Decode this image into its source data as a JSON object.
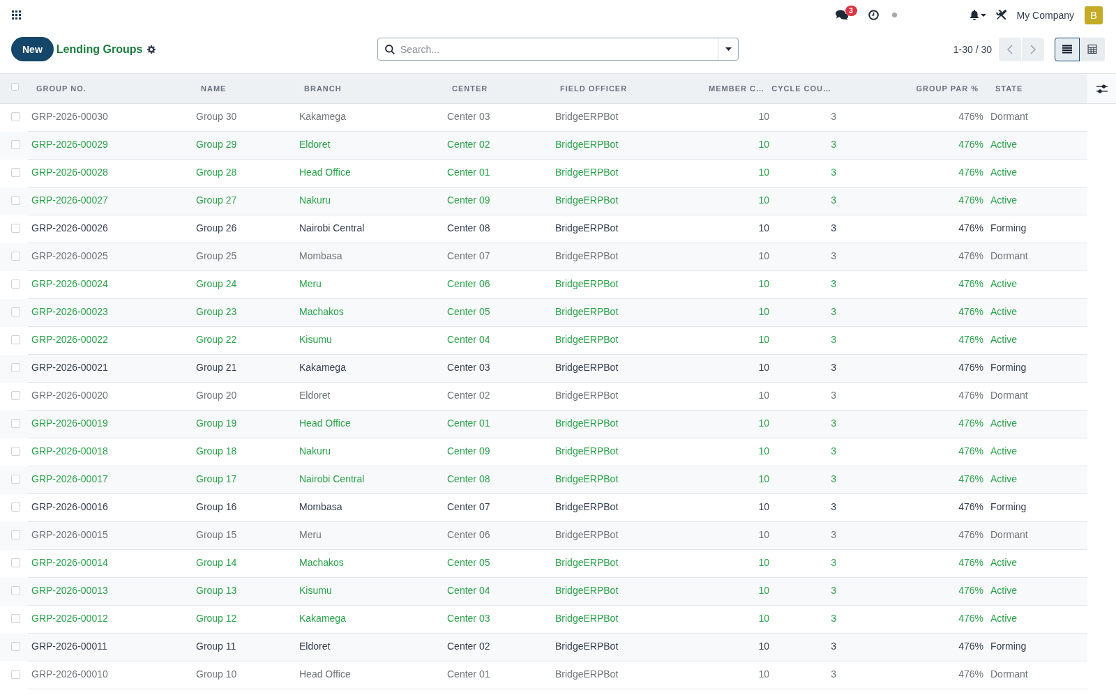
{
  "top_bar": {
    "messages": {
      "badge": "3"
    },
    "company": "My Company",
    "user": {
      "initial": "B"
    }
  },
  "control_panel": {
    "new_button": "New",
    "title": "Lending Groups",
    "search": {
      "placeholder": "Search..."
    },
    "pager": "1-30 / 30",
    "views": [
      {
        "kind": "list",
        "selected": true
      },
      {
        "kind": "pivot",
        "selected": false
      }
    ]
  },
  "table": {
    "select_all": {
      "checked": false
    },
    "columns": [
      {
        "label": "GROUP NO.",
        "kind": "text"
      },
      {
        "label": "NAME",
        "kind": "text"
      },
      {
        "label": "BRANCH",
        "kind": "text"
      },
      {
        "label": "CENTER",
        "kind": "text"
      },
      {
        "label": "FIELD OFFICER",
        "kind": "text"
      },
      {
        "label": "MEMBER C…",
        "kind": "number"
      },
      {
        "label": "CYCLE COU…",
        "kind": "number"
      },
      {
        "label": "GROUP PAR %",
        "kind": "number"
      },
      {
        "label": "STATE",
        "kind": "text"
      }
    ],
    "rows": [
      {
        "kind": "muted",
        "checked": false,
        "cells": [
          "GRP-2026-00030",
          "Group 30",
          "Kakamega",
          "Center 03",
          "BridgeERPBot",
          "10",
          "3",
          "476%",
          "Dormant"
        ]
      },
      {
        "kind": "success",
        "checked": false,
        "cells": [
          "GRP-2026-00029",
          "Group 29",
          "Eldoret",
          "Center 02",
          "BridgeERPBot",
          "10",
          "3",
          "476%",
          "Active"
        ]
      },
      {
        "kind": "success",
        "checked": false,
        "cells": [
          "GRP-2026-00028",
          "Group 28",
          "Head Office",
          "Center 01",
          "BridgeERPBot",
          "10",
          "3",
          "476%",
          "Active"
        ]
      },
      {
        "kind": "success",
        "checked": false,
        "cells": [
          "GRP-2026-00027",
          "Group 27",
          "Nakuru",
          "Center 09",
          "BridgeERPBot",
          "10",
          "3",
          "476%",
          "Active"
        ]
      },
      {
        "kind": "plain",
        "checked": false,
        "cells": [
          "GRP-2026-00026",
          "Group 26",
          "Nairobi Central",
          "Center 08",
          "BridgeERPBot",
          "10",
          "3",
          "476%",
          "Forming"
        ]
      },
      {
        "kind": "muted",
        "checked": false,
        "cells": [
          "GRP-2026-00025",
          "Group 25",
          "Mombasa",
          "Center 07",
          "BridgeERPBot",
          "10",
          "3",
          "476%",
          "Dormant"
        ]
      },
      {
        "kind": "success",
        "checked": false,
        "cells": [
          "GRP-2026-00024",
          "Group 24",
          "Meru",
          "Center 06",
          "BridgeERPBot",
          "10",
          "3",
          "476%",
          "Active"
        ]
      },
      {
        "kind": "success",
        "checked": false,
        "cells": [
          "GRP-2026-00023",
          "Group 23",
          "Machakos",
          "Center 05",
          "BridgeERPBot",
          "10",
          "3",
          "476%",
          "Active"
        ]
      },
      {
        "kind": "success",
        "checked": false,
        "cells": [
          "GRP-2026-00022",
          "Group 22",
          "Kisumu",
          "Center 04",
          "BridgeERPBot",
          "10",
          "3",
          "476%",
          "Active"
        ]
      },
      {
        "kind": "plain",
        "checked": false,
        "cells": [
          "GRP-2026-00021",
          "Group 21",
          "Kakamega",
          "Center 03",
          "BridgeERPBot",
          "10",
          "3",
          "476%",
          "Forming"
        ]
      },
      {
        "kind": "muted",
        "checked": false,
        "cells": [
          "GRP-2026-00020",
          "Group 20",
          "Eldoret",
          "Center 02",
          "BridgeERPBot",
          "10",
          "3",
          "476%",
          "Dormant"
        ]
      },
      {
        "kind": "success",
        "checked": false,
        "cells": [
          "GRP-2026-00019",
          "Group 19",
          "Head Office",
          "Center 01",
          "BridgeERPBot",
          "10",
          "3",
          "476%",
          "Active"
        ]
      },
      {
        "kind": "success",
        "checked": false,
        "cells": [
          "GRP-2026-00018",
          "Group 18",
          "Nakuru",
          "Center 09",
          "BridgeERPBot",
          "10",
          "3",
          "476%",
          "Active"
        ]
      },
      {
        "kind": "success",
        "checked": false,
        "cells": [
          "GRP-2026-00017",
          "Group 17",
          "Nairobi Central",
          "Center 08",
          "BridgeERPBot",
          "10",
          "3",
          "476%",
          "Active"
        ]
      },
      {
        "kind": "plain",
        "checked": false,
        "cells": [
          "GRP-2026-00016",
          "Group 16",
          "Mombasa",
          "Center 07",
          "BridgeERPBot",
          "10",
          "3",
          "476%",
          "Forming"
        ]
      },
      {
        "kind": "muted",
        "checked": false,
        "cells": [
          "GRP-2026-00015",
          "Group 15",
          "Meru",
          "Center 06",
          "BridgeERPBot",
          "10",
          "3",
          "476%",
          "Dormant"
        ]
      },
      {
        "kind": "success",
        "checked": false,
        "cells": [
          "GRP-2026-00014",
          "Group 14",
          "Machakos",
          "Center 05",
          "BridgeERPBot",
          "10",
          "3",
          "476%",
          "Active"
        ]
      },
      {
        "kind": "success",
        "checked": false,
        "cells": [
          "GRP-2026-00013",
          "Group 13",
          "Kisumu",
          "Center 04",
          "BridgeERPBot",
          "10",
          "3",
          "476%",
          "Active"
        ]
      },
      {
        "kind": "success",
        "checked": false,
        "cells": [
          "GRP-2026-00012",
          "Group 12",
          "Kakamega",
          "Center 03",
          "BridgeERPBot",
          "10",
          "3",
          "476%",
          "Active"
        ]
      },
      {
        "kind": "plain",
        "checked": false,
        "cells": [
          "GRP-2026-00011",
          "Group 11",
          "Eldoret",
          "Center 02",
          "BridgeERPBot",
          "10",
          "3",
          "476%",
          "Forming"
        ]
      },
      {
        "kind": "muted",
        "checked": false,
        "cells": [
          "GRP-2026-00010",
          "Group 10",
          "Head Office",
          "Center 01",
          "BridgeERPBot",
          "10",
          "3",
          "476%",
          "Dormant"
        ]
      }
    ]
  }
}
